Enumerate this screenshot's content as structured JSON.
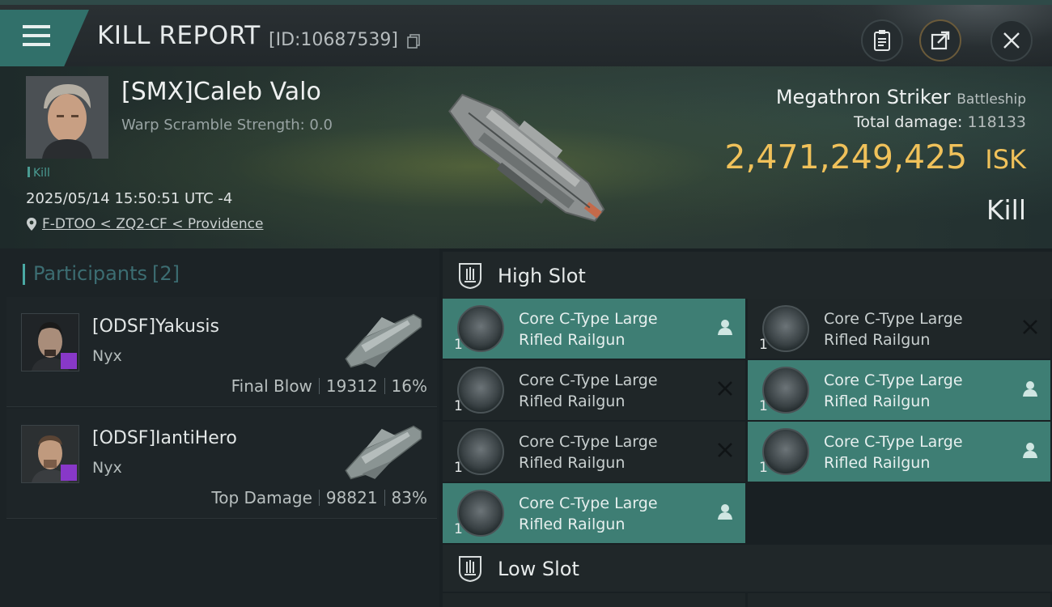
{
  "header": {
    "title": "KILL REPORT",
    "report_id": "[ID:10687539]",
    "icons": {
      "menu": "menu-icon",
      "copy": "copy-icon",
      "clipboard": "clipboard-icon",
      "share": "share-icon",
      "close": "close-icon"
    }
  },
  "victim": {
    "name": "[SMX]Caleb Valo",
    "warp_scramble": "Warp Scramble Strength: 0.0",
    "kill_tag": "Kill",
    "datetime": "2025/05/14 15:50:51 UTC -4",
    "location": "F-DTOO < ZQ2-CF < Providence",
    "ship_name": "Megathron Striker",
    "ship_class": "Battleship",
    "total_damage_label": "Total damage:",
    "total_damage_value": "118133",
    "isk_value": "2,471,249,425",
    "isk_unit": "ISK",
    "result": "Kill"
  },
  "participants": {
    "title": "Participants",
    "count": "[2]",
    "items": [
      {
        "name": "[ODSF]Yakusis",
        "ship": "Nyx",
        "role": "Final Blow",
        "damage": "19312",
        "percent": "16%"
      },
      {
        "name": "[ODSF]IantiHero",
        "ship": "Nyx",
        "role": "Top Damage",
        "damage": "98821",
        "percent": "83%"
      }
    ]
  },
  "slots": {
    "high": {
      "label": "High Slot",
      "modules": [
        {
          "name_line1": "Core C-Type Large",
          "name_line2": "Rifled Railgun",
          "qty": "1",
          "status": "dropped"
        },
        {
          "name_line1": "Core C-Type Large",
          "name_line2": "Rifled Railgun",
          "qty": "1",
          "status": "destroyed"
        },
        {
          "name_line1": "Core C-Type Large",
          "name_line2": "Rifled Railgun",
          "qty": "1",
          "status": "destroyed"
        },
        {
          "name_line1": "Core C-Type Large",
          "name_line2": "Rifled Railgun",
          "qty": "1",
          "status": "dropped"
        },
        {
          "name_line1": "Core C-Type Large",
          "name_line2": "Rifled Railgun",
          "qty": "1",
          "status": "destroyed"
        },
        {
          "name_line1": "Core C-Type Large",
          "name_line2": "Rifled Railgun",
          "qty": "1",
          "status": "dropped"
        },
        {
          "name_line1": "Core C-Type Large",
          "name_line2": "Rifled Railgun",
          "qty": "1",
          "status": "dropped"
        }
      ]
    },
    "low": {
      "label": "Low Slot"
    }
  },
  "colors": {
    "accent": "#3e7e74",
    "isk": "#f0c15a",
    "badge": "#8838c8"
  }
}
